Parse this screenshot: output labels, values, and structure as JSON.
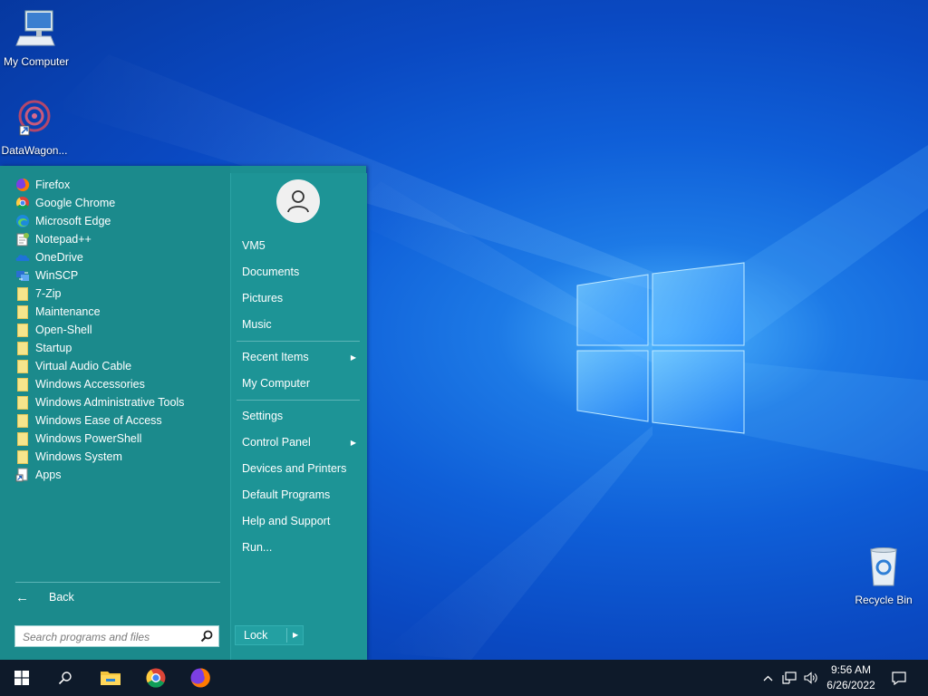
{
  "desktop": {
    "icons": [
      {
        "label": "My Computer",
        "icon": "computer-icon"
      },
      {
        "label": "DataWagon...",
        "icon": "datawagon-icon"
      },
      {
        "label": "Recycle Bin",
        "icon": "recycle-bin-icon"
      }
    ]
  },
  "start_menu": {
    "programs": [
      {
        "label": "Firefox",
        "icon": "firefox-icon"
      },
      {
        "label": "Google Chrome",
        "icon": "chrome-icon"
      },
      {
        "label": "Microsoft Edge",
        "icon": "edge-icon"
      },
      {
        "label": "Notepad++",
        "icon": "notepadpp-icon"
      },
      {
        "label": "OneDrive",
        "icon": "onedrive-icon"
      },
      {
        "label": "WinSCP",
        "icon": "winscp-icon"
      },
      {
        "label": "7-Zip",
        "icon": "folder-icon"
      },
      {
        "label": "Maintenance",
        "icon": "folder-icon"
      },
      {
        "label": "Open-Shell",
        "icon": "folder-icon"
      },
      {
        "label": "Startup",
        "icon": "folder-icon"
      },
      {
        "label": "Virtual Audio Cable",
        "icon": "folder-icon"
      },
      {
        "label": "Windows Accessories",
        "icon": "folder-icon"
      },
      {
        "label": "Windows Administrative Tools",
        "icon": "folder-icon"
      },
      {
        "label": "Windows Ease of Access",
        "icon": "folder-icon"
      },
      {
        "label": "Windows PowerShell",
        "icon": "folder-icon"
      },
      {
        "label": "Windows System",
        "icon": "folder-icon"
      },
      {
        "label": "Apps",
        "icon": "apps-icon"
      }
    ],
    "back_label": "Back",
    "search_placeholder": "Search programs and files",
    "right": {
      "user": "VM5",
      "documents": "Documents",
      "pictures": "Pictures",
      "music": "Music",
      "recent_items": "Recent Items",
      "my_computer": "My Computer",
      "settings": "Settings",
      "control_panel": "Control Panel",
      "devices_printers": "Devices and Printers",
      "default_programs": "Default Programs",
      "help_support": "Help and Support",
      "run": "Run..."
    },
    "lock_label": "Lock"
  },
  "taskbar": {
    "time": "9:56 AM",
    "date": "6/26/2022"
  },
  "colors": {
    "menu_bg": "#1b8a8c",
    "taskbar_bg": "#0e1a2a",
    "desktop_blue": "#0a49c2"
  }
}
